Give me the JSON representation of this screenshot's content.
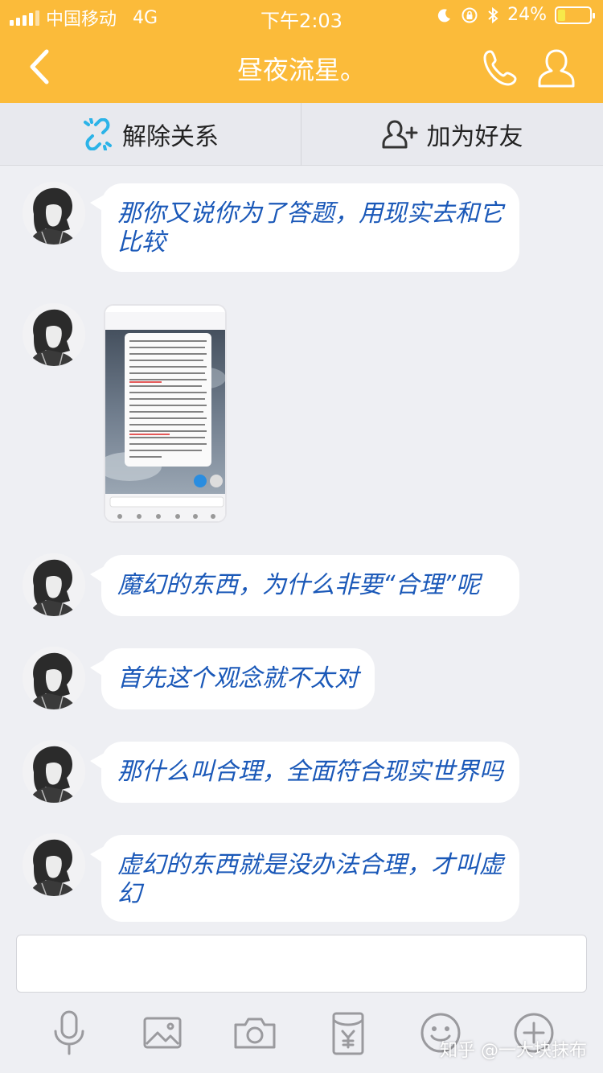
{
  "status_bar": {
    "carrier": "中国移动",
    "network": "4G",
    "time": "下午2:03",
    "battery": "24%",
    "battery_level": 0.24
  },
  "header": {
    "title": "昼夜流星。",
    "accent_color": "#fbbb3a"
  },
  "relation_bar": {
    "unbind_label": "解除关系",
    "add_friend_label": "加为好友"
  },
  "messages": [
    {
      "type": "text",
      "text_lines": [
        "那你又说你为了答题，用现实去和它",
        "比较"
      ]
    },
    {
      "type": "image"
    },
    {
      "type": "text",
      "text_lines": [
        "魔幻的东西，为什么非要“合理”呢"
      ]
    },
    {
      "type": "text",
      "text_lines": [
        "首先这个观念就不太对"
      ]
    },
    {
      "type": "text",
      "text_lines": [
        "那什么叫合理，全面符合现实世界吗"
      ]
    },
    {
      "type": "text",
      "text_lines": [
        "虚幻的东西就是没办法合理，才叫虚",
        "幻"
      ]
    }
  ],
  "toolbar": {
    "icons": [
      "microphone-icon",
      "image-icon",
      "camera-icon",
      "red-packet-icon",
      "emoji-icon",
      "plus-icon"
    ]
  },
  "watermark": "知乎 @一大块抹布"
}
